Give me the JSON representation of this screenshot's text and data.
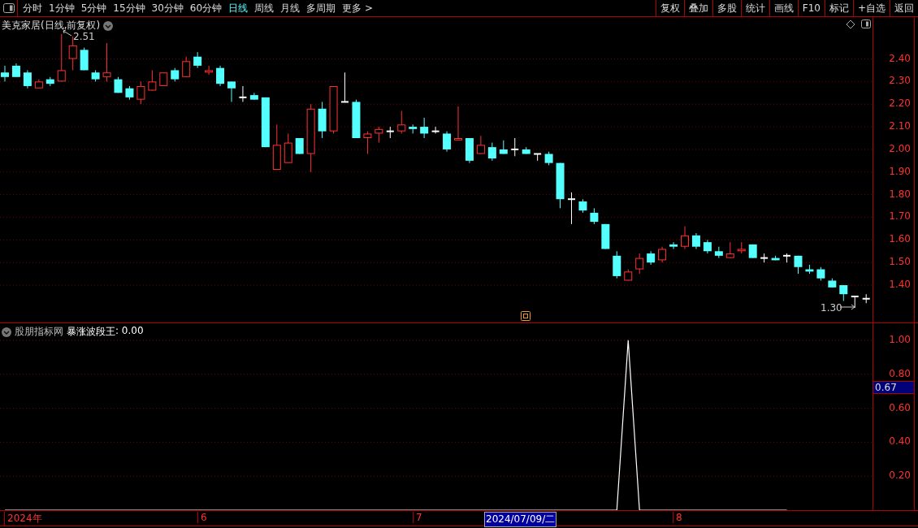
{
  "toolbar": {
    "periods": [
      {
        "label": "分时",
        "selected": false
      },
      {
        "label": "1分钟",
        "selected": false
      },
      {
        "label": "5分钟",
        "selected": false
      },
      {
        "label": "15分钟",
        "selected": false
      },
      {
        "label": "30分钟",
        "selected": false
      },
      {
        "label": "60分钟",
        "selected": false
      },
      {
        "label": "日线",
        "selected": true
      },
      {
        "label": "周线",
        "selected": false
      },
      {
        "label": "月线",
        "selected": false
      },
      {
        "label": "多周期",
        "selected": false
      },
      {
        "label": "更多 >",
        "selected": false
      }
    ],
    "buttons": [
      "复权",
      "叠加",
      "多股",
      "统计",
      "画线",
      "F10",
      "标记",
      "+自选",
      "返回"
    ]
  },
  "price_chart": {
    "title": "美克家居(日线,前复权)",
    "high_marker": "2.51",
    "low_marker": "1.30",
    "chart_data": {
      "type": "candlestick",
      "grid": true,
      "ylim": [
        1.235,
        2.585
      ],
      "yticks": [
        {
          "value": 2.4,
          "label": "2.40"
        },
        {
          "value": 2.3,
          "label": "2.30"
        },
        {
          "value": 2.2,
          "label": "2.20"
        },
        {
          "value": 2.1,
          "label": "2.10"
        },
        {
          "value": 2.0,
          "label": "2.00"
        },
        {
          "value": 1.9,
          "label": "1.90"
        },
        {
          "value": 1.8,
          "label": "1.80"
        },
        {
          "value": 1.7,
          "label": "1.70"
        },
        {
          "value": 1.6,
          "label": "1.60"
        },
        {
          "value": 1.5,
          "label": "1.50"
        },
        {
          "value": 1.4,
          "label": "1.40"
        }
      ],
      "ohlc": [
        [
          2.34,
          2.37,
          2.3,
          2.32
        ],
        [
          2.37,
          2.38,
          2.32,
          2.32
        ],
        [
          2.34,
          2.35,
          2.27,
          2.28
        ],
        [
          2.27,
          2.31,
          2.27,
          2.3
        ],
        [
          2.31,
          2.32,
          2.28,
          2.29
        ],
        [
          2.3,
          2.51,
          2.3,
          2.35
        ],
        [
          2.4,
          2.5,
          2.35,
          2.46
        ],
        [
          2.44,
          2.45,
          2.35,
          2.35
        ],
        [
          2.34,
          2.35,
          2.3,
          2.31
        ],
        [
          2.32,
          2.47,
          2.3,
          2.34
        ],
        [
          2.31,
          2.32,
          2.25,
          2.25
        ],
        [
          2.27,
          2.28,
          2.22,
          2.23
        ],
        [
          2.22,
          2.3,
          2.2,
          2.28
        ],
        [
          2.26,
          2.35,
          2.26,
          2.3
        ],
        [
          2.28,
          2.34,
          2.28,
          2.34
        ],
        [
          2.35,
          2.36,
          2.3,
          2.31
        ],
        [
          2.32,
          2.41,
          2.32,
          2.39
        ],
        [
          2.41,
          2.43,
          2.36,
          2.37
        ],
        [
          2.34,
          2.37,
          2.33,
          2.35
        ],
        [
          2.36,
          2.37,
          2.28,
          2.29
        ],
        [
          2.3,
          2.3,
          2.21,
          2.27
        ],
        [
          2.23,
          2.28,
          2.21,
          2.23
        ],
        [
          2.24,
          2.25,
          2.22,
          2.22
        ],
        [
          2.23,
          2.23,
          2.01,
          2.01
        ],
        [
          1.91,
          2.11,
          1.91,
          2.02
        ],
        [
          1.94,
          2.07,
          1.94,
          2.03
        ],
        [
          2.05,
          2.05,
          1.98,
          1.98
        ],
        [
          1.98,
          2.2,
          1.9,
          2.18
        ],
        [
          2.18,
          2.21,
          2.05,
          2.08
        ],
        [
          2.08,
          2.28,
          2.07,
          2.28
        ],
        [
          2.21,
          2.34,
          2.21,
          2.21
        ],
        [
          2.21,
          2.22,
          2.05,
          2.05
        ],
        [
          2.05,
          2.08,
          1.98,
          2.07
        ],
        [
          2.07,
          2.1,
          2.03,
          2.09
        ],
        [
          2.08,
          2.1,
          2.05,
          2.08
        ],
        [
          2.08,
          2.17,
          2.07,
          2.11
        ],
        [
          2.1,
          2.11,
          2.07,
          2.09
        ],
        [
          2.1,
          2.14,
          2.05,
          2.07
        ],
        [
          2.08,
          2.1,
          2.07,
          2.08
        ],
        [
          2.07,
          2.08,
          1.99,
          2.0
        ],
        [
          2.04,
          2.19,
          2.04,
          2.05
        ],
        [
          2.05,
          2.05,
          1.94,
          1.95
        ],
        [
          1.98,
          2.06,
          1.98,
          2.02
        ],
        [
          2.01,
          2.03,
          1.95,
          1.96
        ],
        [
          2.0,
          2.04,
          1.98,
          1.98
        ],
        [
          2.0,
          2.05,
          1.97,
          2.0
        ],
        [
          2.0,
          2.01,
          1.98,
          1.98
        ],
        [
          1.98,
          1.98,
          1.95,
          1.98
        ],
        [
          1.98,
          1.99,
          1.93,
          1.94
        ],
        [
          1.94,
          1.94,
          1.74,
          1.78
        ],
        [
          1.78,
          1.81,
          1.67,
          1.78
        ],
        [
          1.77,
          1.78,
          1.72,
          1.73
        ],
        [
          1.72,
          1.74,
          1.67,
          1.68
        ],
        [
          1.67,
          1.67,
          1.56,
          1.56
        ],
        [
          1.53,
          1.55,
          1.43,
          1.44
        ],
        [
          1.42,
          1.47,
          1.42,
          1.46
        ],
        [
          1.47,
          1.54,
          1.45,
          1.52
        ],
        [
          1.54,
          1.55,
          1.49,
          1.5
        ],
        [
          1.51,
          1.57,
          1.5,
          1.56
        ],
        [
          1.58,
          1.59,
          1.56,
          1.57
        ],
        [
          1.57,
          1.66,
          1.56,
          1.62
        ],
        [
          1.62,
          1.63,
          1.56,
          1.57
        ],
        [
          1.59,
          1.6,
          1.54,
          1.55
        ],
        [
          1.55,
          1.57,
          1.52,
          1.53
        ],
        [
          1.52,
          1.59,
          1.52,
          1.54
        ],
        [
          1.55,
          1.59,
          1.54,
          1.56
        ],
        [
          1.58,
          1.58,
          1.52,
          1.52
        ],
        [
          1.52,
          1.54,
          1.5,
          1.52
        ],
        [
          1.52,
          1.53,
          1.51,
          1.51
        ],
        [
          1.53,
          1.54,
          1.5,
          1.53
        ],
        [
          1.53,
          1.53,
          1.45,
          1.48
        ],
        [
          1.47,
          1.49,
          1.45,
          1.46
        ],
        [
          1.47,
          1.48,
          1.42,
          1.43
        ],
        [
          1.42,
          1.43,
          1.39,
          1.39
        ],
        [
          1.4,
          1.4,
          1.33,
          1.36
        ],
        [
          1.35,
          1.35,
          1.3,
          1.35
        ],
        [
          1.34,
          1.36,
          1.32,
          1.34
        ]
      ]
    }
  },
  "indicator": {
    "source": "股朋指标网",
    "value": ": 0.00",
    "cursor_value": "0.67",
    "chart_data": {
      "type": "line",
      "grid": true,
      "ylim": [
        0,
        1.1
      ],
      "yticks": [
        {
          "value": 1.0,
          "label": "1.00"
        },
        {
          "value": 0.8,
          "label": "0.80"
        },
        {
          "value": 0.6,
          "label": "0.60"
        },
        {
          "value": 0.4,
          "label": "0.40"
        },
        {
          "value": 0.2,
          "label": "0.20"
        }
      ],
      "series": [
        {
          "name": "暴涨波段王",
          "color": "#ffffff",
          "values": [
            0,
            0,
            0,
            0,
            0,
            0,
            0,
            0,
            0,
            0,
            0,
            0,
            0,
            0,
            0,
            0,
            0,
            0,
            0,
            0,
            0,
            0,
            0,
            0,
            0,
            0,
            0,
            0,
            0,
            0,
            0,
            0,
            0,
            0,
            0,
            0,
            0,
            0,
            0,
            0,
            0,
            0,
            0,
            0,
            0,
            0,
            0,
            0,
            0,
            0,
            0,
            0,
            0,
            0,
            0,
            1,
            0,
            0,
            0,
            0,
            0,
            0,
            0,
            0,
            0,
            0,
            0,
            0,
            0,
            0
          ]
        }
      ]
    }
  },
  "time_axis": {
    "labels": [
      "2024年",
      "6",
      "7",
      "8"
    ],
    "cursor_date": "2024/07/09/二"
  }
}
